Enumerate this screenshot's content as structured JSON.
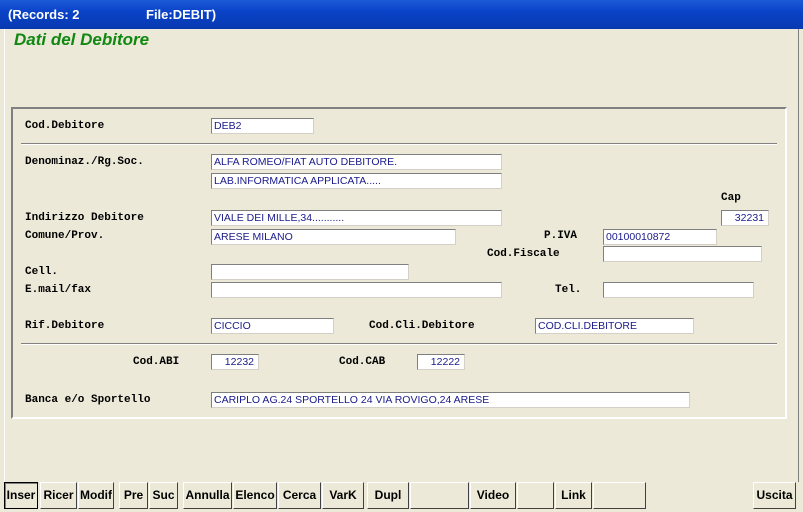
{
  "titlebar": {
    "records": "(Records: 2",
    "file": "File:DEBIT)"
  },
  "heading": "Dati del Debitore",
  "labels": {
    "cod_debitore": "Cod.Debitore",
    "denominaz": "Denominaz./Rg.Soc.",
    "cap": "Cap",
    "indirizzo": "Indirizzo Debitore",
    "comune": "Comune/Prov.",
    "piva": "P.IVA",
    "cod_fiscale": "Cod.Fiscale",
    "cell": "Cell.",
    "email": "E.mail/fax",
    "tel": "Tel.",
    "rif": "Rif.Debitore",
    "cod_cli": "Cod.Cli.Debitore",
    "abi": "Cod.ABI",
    "cab": "Cod.CAB",
    "banca": "Banca e/o Sportello"
  },
  "fields": {
    "cod_debitore": "DEB2",
    "denominaz_1": "ALFA ROMEO/FIAT AUTO DEBITORE.",
    "denominaz_2": "LAB.INFORMATICA APPLICATA.....",
    "cap": "32231",
    "indirizzo": "VIALE DEI MILLE,34...........",
    "comune": "ARESE MILANO",
    "piva": "00100010872",
    "cod_fiscale": "",
    "cell": "",
    "email": "",
    "tel": "",
    "rif": "CICCIO",
    "cod_cli": "COD.CLI.DEBITORE",
    "abi": "12232",
    "cab": "12222",
    "banca": "CARIPLO AG.24 SPORTELLO 24 VIA ROVIGO,24 ARESE"
  },
  "toolbar": {
    "inser": "Inser",
    "ricer": "Ricer",
    "modif": "Modif",
    "pre": "Pre",
    "suc": "Suc",
    "annulla": "Annulla",
    "elenco": "Elenco",
    "cerca": "Cerca",
    "vark": "VarK",
    "dupl": "Dupl",
    "blank1": "",
    "video": "Video",
    "blank2": "",
    "link": "Link",
    "blank3": "",
    "uscita": "Uscita"
  }
}
